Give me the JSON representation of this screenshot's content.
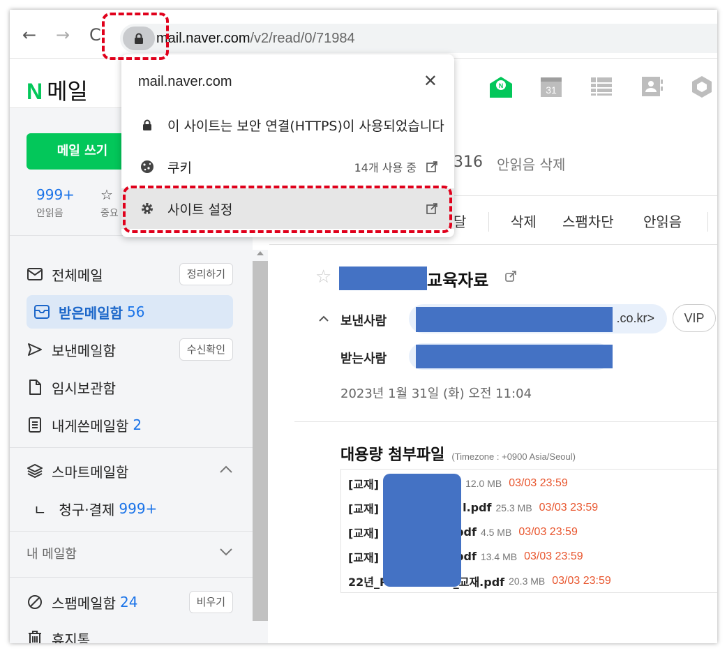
{
  "browser": {
    "back_icon": "arrow-left-icon",
    "forward_icon": "arrow-right-icon",
    "reload_icon": "reload-icon",
    "lock_icon": "lock-icon",
    "url_host": "mail.naver.com",
    "url_path": "/v2/read/0/71984"
  },
  "site_info_popup": {
    "host": "mail.naver.com",
    "close_label": "✕",
    "secure_text": "이 사이트는 보안 연결(HTTPS)이 사용되었습니다",
    "cookies_label": "쿠키",
    "cookies_status": "14개 사용 중",
    "site_settings_label": "사이트 설정"
  },
  "header": {
    "logo_mark": "N",
    "logo_text": "메일"
  },
  "sidebar": {
    "compose_label": "메일 쓰기",
    "stats": [
      {
        "num": "999+",
        "label": "안읽음"
      },
      {
        "num": "☆",
        "label": "중요"
      }
    ],
    "items": [
      {
        "label": "전체메일",
        "action": "정리하기"
      },
      {
        "label": "받은메일함",
        "count": "56"
      },
      {
        "label": "보낸메일함",
        "action": "수신확인"
      },
      {
        "label": "임시보관함"
      },
      {
        "label": "내게쓴메일함",
        "count": "2"
      },
      {
        "label": "스마트메일함"
      },
      {
        "label": "청구·결제",
        "count": "999+",
        "prefix": "ㄴ"
      },
      {
        "label": "내 메일함"
      },
      {
        "label": "스팸메일함",
        "count": "24",
        "action": "비우기"
      },
      {
        "label": "휴지통"
      }
    ]
  },
  "main": {
    "unread_count": "316",
    "unread_delete": "안읽음 삭제",
    "toolbar": [
      "달",
      "삭제",
      "스팸차단",
      "안읽음"
    ],
    "subject_suffix": "교육자료",
    "sender_label": "보낸사람",
    "sender_domain": ".co.kr>",
    "vip_label": "VIP",
    "receiver_label": "받는사람",
    "date": "2023년 1월 31일 (화) 오전 11:04",
    "attach_title": "대용량 첨부파일",
    "timezone": "(Timezone : +0900 Asia/Seoul)",
    "attachments": [
      {
        "name": "[교재]",
        "size": "12.0 MB",
        "expires": "03/03 23:59"
      },
      {
        "name": "[교재]",
        "name_end": "l.pdf",
        "size": "25.3 MB",
        "expires": "03/03 23:59"
      },
      {
        "name": "[교재]",
        "name_end": "pdf",
        "size": "4.5 MB",
        "expires": "03/03 23:59"
      },
      {
        "name": "[교재]",
        "name_end": "pdf",
        "size": "13.4 MB",
        "expires": "03/03 23:59"
      },
      {
        "name": "22년_P",
        "name_end": "_교재.pdf",
        "size": "20.3 MB",
        "expires": "03/03 23:59"
      }
    ]
  }
}
